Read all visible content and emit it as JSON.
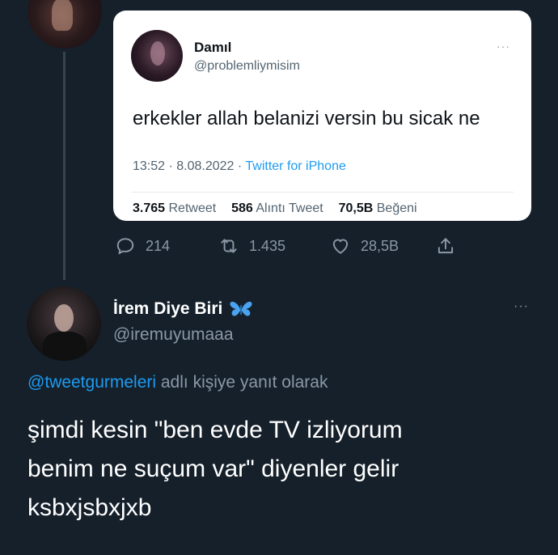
{
  "quoted_tweet": {
    "name": "Damıl",
    "handle": "@problemliymisim",
    "more": "···",
    "text": "erkekler allah belanizi versin bu sicak ne",
    "time": "13:52 · 8.08.2022 · ",
    "source": "Twitter for iPhone",
    "stats": {
      "retweets_value": "3.765",
      "retweets_label": "Retweet",
      "quotes_value": "586",
      "quotes_label": "Alıntı Tweet",
      "likes_value": "70,5B",
      "likes_label": "Beğeni"
    }
  },
  "actions": {
    "replies": "214",
    "retweets": "1.435",
    "likes": "28,5B"
  },
  "reply_tweet": {
    "name": "İrem Diye Biri",
    "handle": "@iremuyumaaa",
    "more": "···",
    "replying_to": "@tweetgurmeleri",
    "replying_suffix": " adlı kişiye yanıt olarak",
    "body_lines": [
      "şimdi kesin \"ben evde TV izliyorum",
      "benim ne suçum var\" diyenler gelir",
      "ksbxjsbxjxb"
    ]
  },
  "colors": {
    "background": "#15202b",
    "accent": "#1d9bf0",
    "secondary_text": "#8b98a5"
  },
  "icons": [
    "reply-icon",
    "retweet-icon",
    "like-icon",
    "share-icon",
    "butterfly-icon",
    "more-icon"
  ]
}
